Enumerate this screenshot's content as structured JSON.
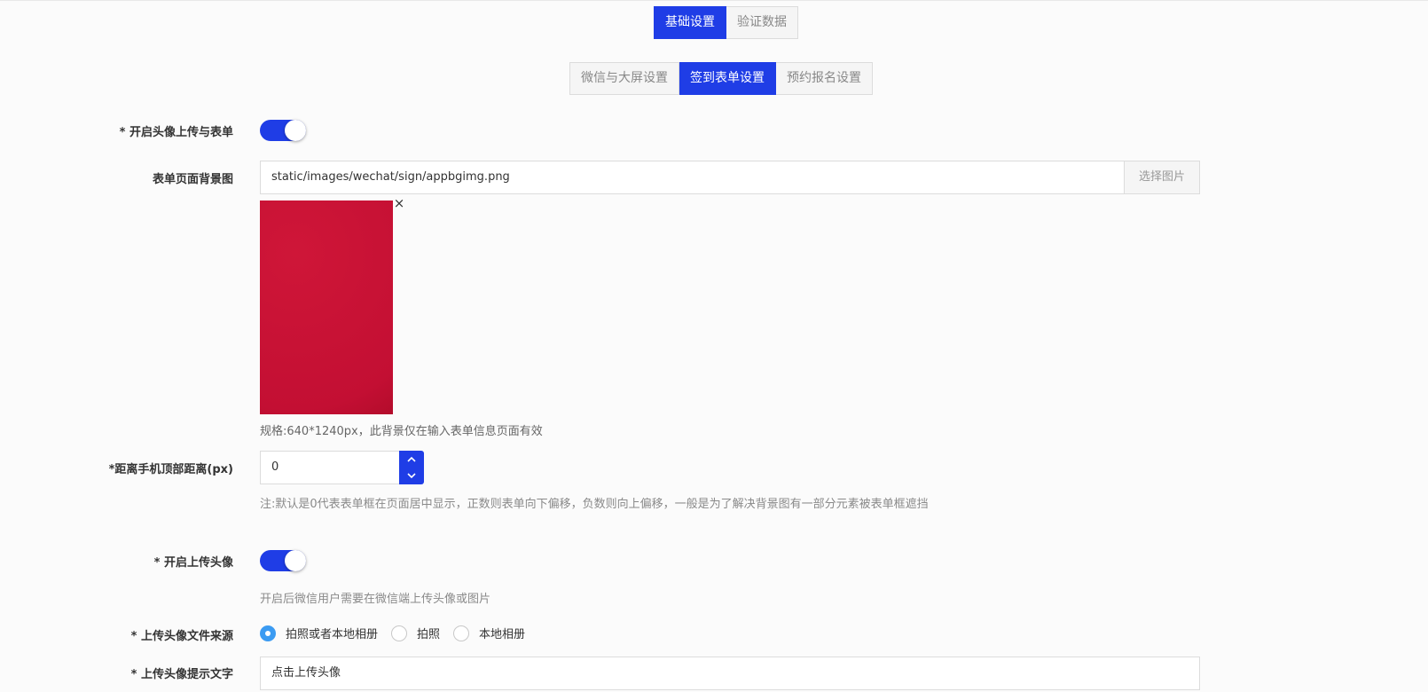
{
  "tabs_primary": [
    {
      "label": "基础设置",
      "active": true
    },
    {
      "label": "验证数据",
      "active": false
    }
  ],
  "tabs_secondary": [
    {
      "label": "微信与大屏设置",
      "active": false
    },
    {
      "label": "签到表单设置",
      "active": true
    },
    {
      "label": "预约报名设置",
      "active": false
    }
  ],
  "form": {
    "enable_avatar_form": {
      "label": "* 开启头像上传与表单",
      "enabled": true
    },
    "bg_image": {
      "label": "表单页面背景图",
      "value": "static/images/wechat/sign/appbgimg.png",
      "choose_button": "选择图片",
      "remove_icon": "×",
      "hint": "规格:640*1240px，此背景仅在输入表单信息页面有效"
    },
    "top_distance": {
      "label": "*距离手机顶部距离(px)",
      "value": "0",
      "hint": "注:默认是0代表表单框在页面居中显示，正数则表单向下偏移，负数则向上偏移，一般是为了解决背景图有一部分元素被表单框遮挡"
    },
    "enable_avatar": {
      "label": "* 开启上传头像",
      "enabled": true,
      "hint": "开启后微信用户需要在微信端上传头像或图片"
    },
    "avatar_source": {
      "label": "* 上传头像文件来源",
      "options": [
        {
          "label": "拍照或者本地相册",
          "checked": true
        },
        {
          "label": "拍照",
          "checked": false
        },
        {
          "label": "本地相册",
          "checked": false
        }
      ]
    },
    "avatar_prompt": {
      "label": "* 上传头像提示文字",
      "value": "点击上传头像"
    }
  },
  "colors": {
    "primary": "#1f3de6",
    "radio_checked": "#3b9bf2"
  }
}
